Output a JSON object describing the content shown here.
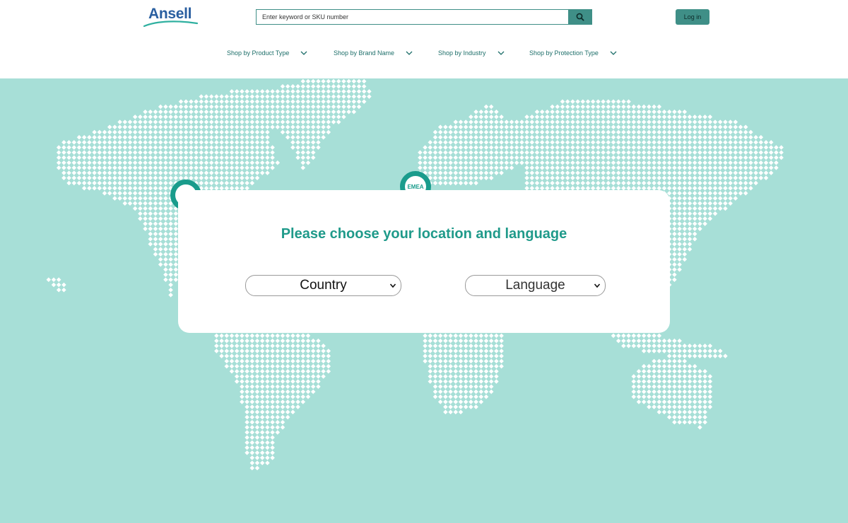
{
  "header": {
    "logo_text": "Ansell",
    "search": {
      "placeholder": "Enter keyword or SKU number",
      "button_icon": "search-icon"
    },
    "login_label": "Log in"
  },
  "nav": {
    "items": [
      {
        "label": "Shop by Product Type",
        "icon": "chevron-down-icon"
      },
      {
        "label": "Shop by Brand Name",
        "icon": "chevron-down-icon"
      },
      {
        "label": "Shop by Industry",
        "icon": "chevron-down-icon"
      },
      {
        "label": "Shop by Protection Type",
        "icon": "chevron-down-icon"
      }
    ]
  },
  "map": {
    "background_color": "#a7dfd7",
    "dot_color": "#ffffff",
    "pins": [
      {
        "label": ""
      },
      {
        "label": "EMEA"
      }
    ]
  },
  "modal": {
    "title": "Please choose your location and language",
    "country_select": {
      "value": "Country"
    },
    "language_select": {
      "value": "Language"
    }
  },
  "colors": {
    "accent": "#3f8f87",
    "title": "#1f9a8a",
    "nav_text": "#1e6f6a",
    "logo": "#2a5fa0"
  }
}
